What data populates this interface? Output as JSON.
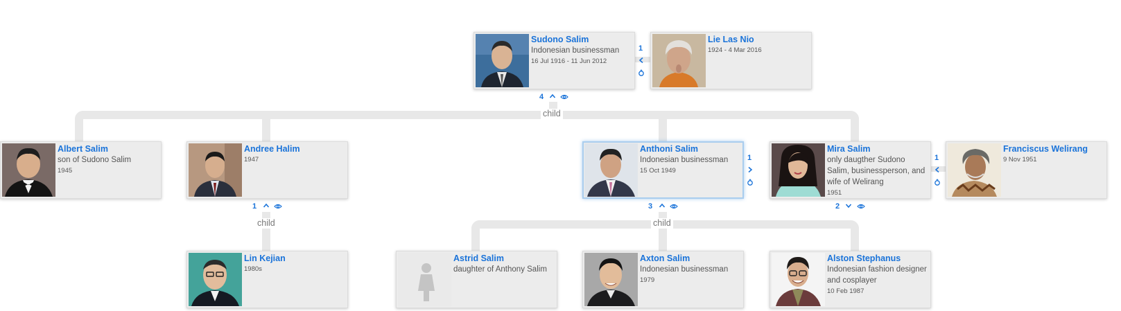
{
  "people": {
    "sudono": {
      "name": "Sudono Salim",
      "desc": "Indonesian businessman",
      "dates": "16 Jul 1916 - 11 Jun 2012"
    },
    "lie": {
      "name": "Lie Las Nio",
      "desc": "",
      "dates": "1924 - 4 Mar 2016"
    },
    "albert": {
      "name": "Albert Salim",
      "desc": "son of Sudono Salim",
      "dates": "1945"
    },
    "andree": {
      "name": "Andree Halim",
      "desc": "",
      "dates": "1947"
    },
    "anthoni": {
      "name": "Anthoni Salim",
      "desc": "Indonesian businessman",
      "dates": "15 Oct 1949"
    },
    "mira": {
      "name": "Mira Salim",
      "desc": "only daugther Sudono Salim, businessperson, and wife of Welirang",
      "dates": "1951"
    },
    "franciscus": {
      "name": "Franciscus Welirang",
      "desc": "",
      "dates": "9 Nov 1951"
    },
    "lin": {
      "name": "Lin Kejian",
      "desc": "",
      "dates": "1980s"
    },
    "astrid": {
      "name": "Astrid Salim",
      "desc": "daughter of Anthony Salim",
      "dates": ""
    },
    "axton": {
      "name": "Axton Salim",
      "desc": "Indonesian businessman",
      "dates": "1979"
    },
    "alston": {
      "name": "Alston Stephanus",
      "desc": "Indonesian fashion designer and cosplayer",
      "dates": "10 Feb 1987"
    }
  },
  "counts": {
    "sudono_spouses": "1",
    "sudono_children": "4",
    "andree_children": "1",
    "anthoni_spouses": "1",
    "anthoni_children": "3",
    "mira_spouses": "1",
    "mira_children": "2"
  },
  "labels": {
    "child": "child"
  },
  "colors": {
    "link": "#1a73d9",
    "card": "#ececec",
    "connector": "#e8e8e8",
    "focus": "#a9cdee"
  },
  "icons": {
    "collapse": "chevron-up-icon",
    "expand": "chevron-down-icon",
    "view": "eye-icon",
    "spouse_left": "chevron-left-icon",
    "spouse_right": "chevron-right-icon",
    "ring": "ring-icon"
  }
}
